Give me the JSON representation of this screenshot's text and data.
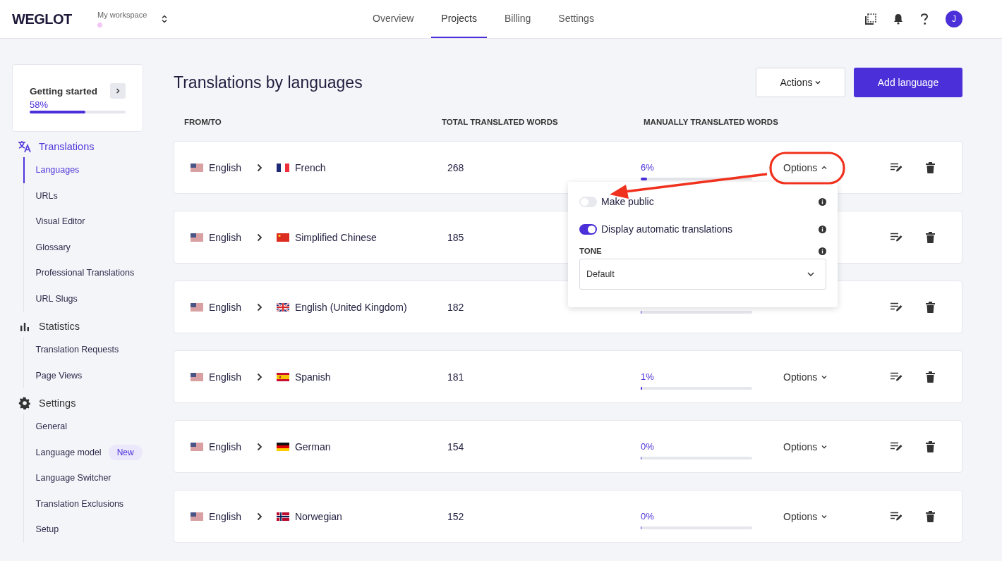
{
  "header": {
    "logo": "WEGLOT",
    "workspace_label": "My workspace",
    "tabs": [
      {
        "label": "Overview",
        "selected": false
      },
      {
        "label": "Projects",
        "selected": true
      },
      {
        "label": "Billing",
        "selected": false
      },
      {
        "label": "Settings",
        "selected": false
      }
    ],
    "avatar_initial": "J"
  },
  "sidebar": {
    "getting_started": {
      "title": "Getting started",
      "percent": "58%",
      "level": 0.58
    },
    "groups": [
      {
        "kind": "translate",
        "label": "Translations",
        "selected": true,
        "items": [
          {
            "label": "Languages",
            "selected": true
          },
          {
            "label": "URLs",
            "selected": false
          },
          {
            "label": "Visual Editor",
            "selected": false
          },
          {
            "label": "Glossary",
            "selected": false
          },
          {
            "label": "Professional Translations",
            "selected": false
          },
          {
            "label": "URL Slugs",
            "selected": false
          }
        ]
      },
      {
        "kind": "chart",
        "label": "Statistics",
        "selected": false,
        "items": [
          {
            "label": "Translation Requests",
            "selected": false
          },
          {
            "label": "Page Views",
            "selected": false
          }
        ]
      },
      {
        "kind": "gear",
        "label": "Settings",
        "selected": false,
        "items": [
          {
            "label": "General",
            "selected": false
          },
          {
            "label": "Language model",
            "selected": false,
            "badge": "New"
          },
          {
            "label": "Language Switcher",
            "selected": false
          },
          {
            "label": "Translation Exclusions",
            "selected": false
          },
          {
            "label": "Setup",
            "selected": false
          }
        ]
      }
    ]
  },
  "page": {
    "title": "Translations by languages",
    "actions_button": "Actions",
    "add_button": "Add language"
  },
  "table": {
    "columns": [
      "FROM/TO",
      "TOTAL TRANSLATED WORDS",
      "MANUALLY TRANSLATED WORDS"
    ],
    "rows": [
      {
        "source": {
          "name": "English",
          "kind": "us"
        },
        "target": {
          "name": "French",
          "kind": "fr"
        },
        "total": "268",
        "percent": "6%",
        "level": 0.06,
        "options": "Options",
        "expanded": true
      },
      {
        "source": {
          "name": "English",
          "kind": "us"
        },
        "target": {
          "name": "Simplified Chinese",
          "kind": "cn"
        },
        "total": "185"
      },
      {
        "source": {
          "name": "English",
          "kind": "us"
        },
        "target": {
          "name": "English (United Kingdom)",
          "kind": "gb"
        },
        "total": "182",
        "level": 0
      },
      {
        "source": {
          "name": "English",
          "kind": "us"
        },
        "target": {
          "name": "Spanish",
          "kind": "es"
        },
        "total": "181",
        "percent": "1%",
        "level": 0.01,
        "options": "Options",
        "expanded": false
      },
      {
        "source": {
          "name": "English",
          "kind": "us"
        },
        "target": {
          "name": "German",
          "kind": "de"
        },
        "total": "154",
        "percent": "0%",
        "level": 0,
        "options": "Options",
        "expanded": false
      },
      {
        "source": {
          "name": "English",
          "kind": "us"
        },
        "target": {
          "name": "Norwegian",
          "kind": "no"
        },
        "total": "152",
        "percent": "0%",
        "level": 0,
        "options": "Options",
        "expanded": false
      }
    ]
  },
  "options_menu": {
    "toggles": [
      {
        "label": "Make public",
        "on": false
      },
      {
        "label": "Display automatic translations",
        "on": true
      }
    ],
    "tone_label": "TONE",
    "tone_value": "Default"
  }
}
